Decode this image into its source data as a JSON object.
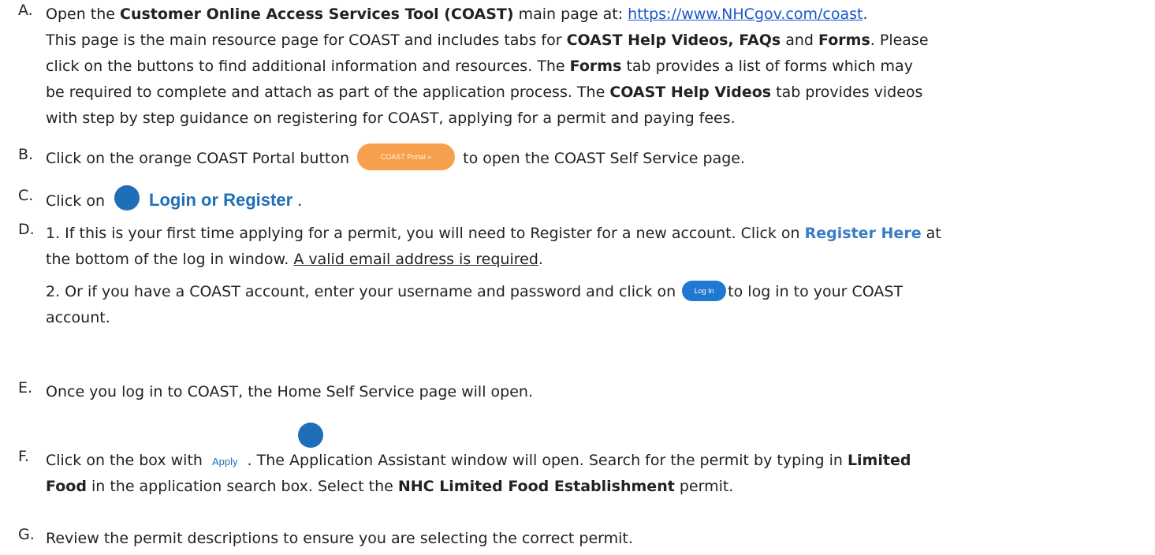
{
  "items": {
    "a": {
      "letter": "A.",
      "t1": "Open the ",
      "b1": "Customer Online Access Services Tool (COAST)",
      "t2": " main page at: ",
      "link": "https://www.NHCgov.com/coast",
      "t3": ".",
      "l2a": "This page is the main resource page for COAST and includes tabs for ",
      "l2b": "COAST Help Videos, FAQs",
      "l2c": " and ",
      "l2d": "Forms",
      "l2e": ".  Please",
      "l3": "click on the buttons to find additional information and resources.  The ",
      "l3b": "Forms",
      "l3c": " tab provides a list of forms which may",
      "l4": "be required to complete and attach as part of the application process.  The ",
      "l4b": "COAST Help Videos",
      "l4c": " tab provides videos",
      "l5": "with step by step guidance on registering for COAST, applying for a permit and paying fees."
    },
    "b": {
      "letter": "B.",
      "t1": "Click on the orange COAST Portal button ",
      "button": "COAST Portal »",
      "t2": " to open the COAST Self Service page."
    },
    "c": {
      "letter": "C.",
      "t1": "Click on ",
      "login": "Login or Register",
      "t2": " ."
    },
    "d": {
      "letter": "D.",
      "l1a": "1. If this is your first time applying for a permit, you will need to Register for a new account. Click on ",
      "l1b": "Register Here",
      "l1c": " at",
      "l2a": "the bottom of the log in window. ",
      "l2b": "A valid email address is required",
      "l2c": ".",
      "l3a": "2. Or if you have a COAST account, enter your username and password and click on ",
      "button": "Log In",
      "l3b": "to log in to your COAST",
      "l4": "account."
    },
    "e": {
      "letter": "E.",
      "text": "Once you log in to COAST, the Home Self Service page will open."
    },
    "f": {
      "letter": "F.",
      "t1": "Click on the box with ",
      "apply": "Apply",
      "t2": " . The Application Assistant window will open.  Search for the permit by typing in ",
      "b1": "Limited",
      "l2a": "Food",
      "l2b": " in the application search box. Select the ",
      "l2c": "NHC Limited Food Establishment",
      "l2d": " permit."
    },
    "g": {
      "letter": "G.",
      "text": "Review the permit descriptions to ensure you are selecting the correct permit."
    }
  }
}
